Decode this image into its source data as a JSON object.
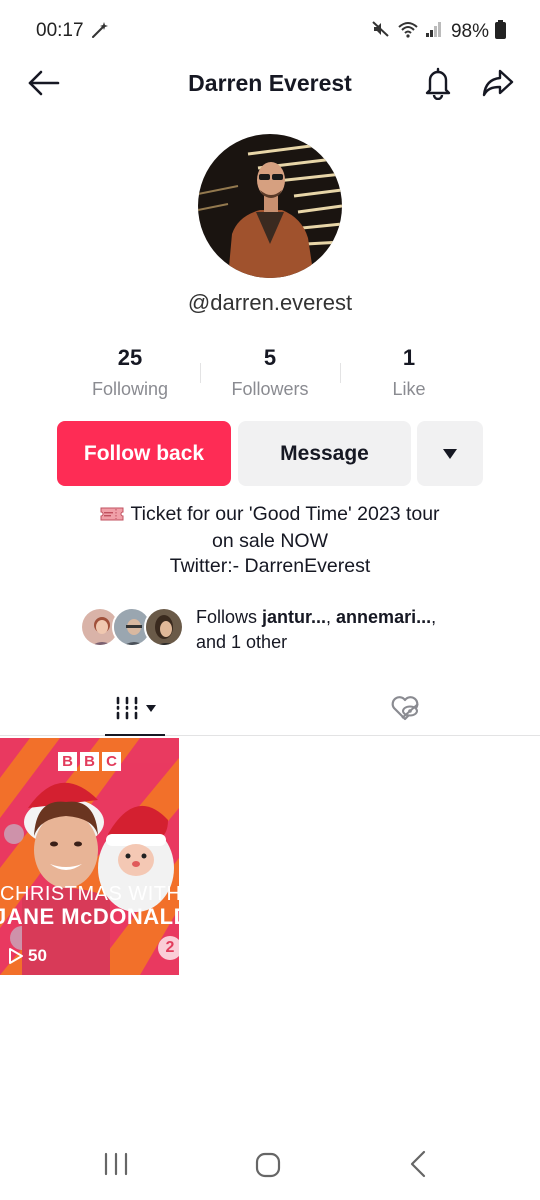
{
  "status_bar": {
    "time": "00:17",
    "battery": "98%"
  },
  "header": {
    "title": "Darren Everest"
  },
  "profile": {
    "username": "@darren.everest",
    "stats": [
      {
        "value": "25",
        "label": "Following"
      },
      {
        "value": "5",
        "label": "Followers"
      },
      {
        "value": "1",
        "label": "Like"
      }
    ],
    "follow_label": "Follow back",
    "message_label": "Message",
    "bio_lines": [
      "Ticket for our 'Good Time'  2023 tour",
      "on sale NOW",
      "Twitter:- DarrenEverest"
    ],
    "mutuals": {
      "prefix": "Follows ",
      "name1": "jantur...",
      "sep": ", ",
      "name2": "annemari...",
      "suffix": ",",
      "line2": "and 1 other"
    }
  },
  "videos": [
    {
      "line1": "CHRISTMAS WITH",
      "line2": "JANE McDONALD",
      "channel_letters": [
        "B",
        "B",
        "C"
      ],
      "channel_number": "2",
      "views": "50"
    }
  ],
  "colors": {
    "accent": "#fe2c55",
    "secondary_button": "#f1f1f2",
    "text_primary": "#161823",
    "text_secondary": "#8a8b91"
  },
  "icons": {
    "back": "arrow-left-icon",
    "bell": "bell-icon",
    "share": "share-icon",
    "more": "caret-down-icon",
    "videos_tab": "grid-icon",
    "liked_tab": "hidden-heart-icon"
  }
}
